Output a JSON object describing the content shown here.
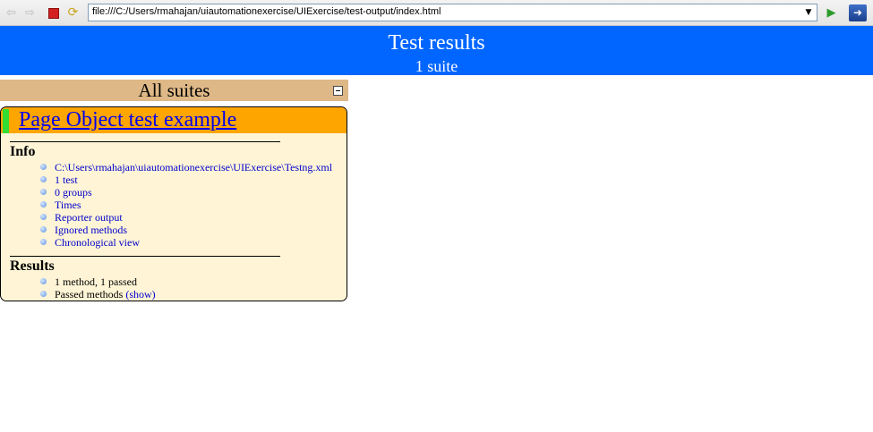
{
  "browser": {
    "back_icon": "back-arrow-icon",
    "forward_icon": "forward-arrow-icon",
    "stop_icon": "stop-icon",
    "refresh_icon": "refresh-icon",
    "address": "file:///C:/Users/rmahajan/uiautomationexercise/UIExercise/test-output/index.html",
    "go_icon": "go-arrow-icon",
    "extension_icon": "extension-icon"
  },
  "header": {
    "title": "Test results",
    "subtitle": "1 suite"
  },
  "suites": {
    "title": "All suites",
    "collapse_icon": "collapse-icon"
  },
  "suite": {
    "name": "Page Object test example",
    "info": {
      "heading": "Info",
      "items": [
        "C:\\Users\\rmahajan\\uiautomationexercise\\UIExercise\\Testng.xml",
        "1 test",
        "0 groups",
        "Times",
        "Reporter output",
        "Ignored methods",
        "Chronological view"
      ]
    },
    "results": {
      "heading": "Results",
      "summary": "1 method, 1 passed",
      "passed_label": "Passed methods",
      "show_link": "(show)"
    }
  },
  "colors": {
    "header_bg": "#0066ff",
    "suites_bar_bg": "#deb887",
    "suite_header_bg": "#ffa500",
    "suite_body_bg": "#fff5d6",
    "pass_indicator": "#33dd33",
    "link": "#0000cc"
  }
}
